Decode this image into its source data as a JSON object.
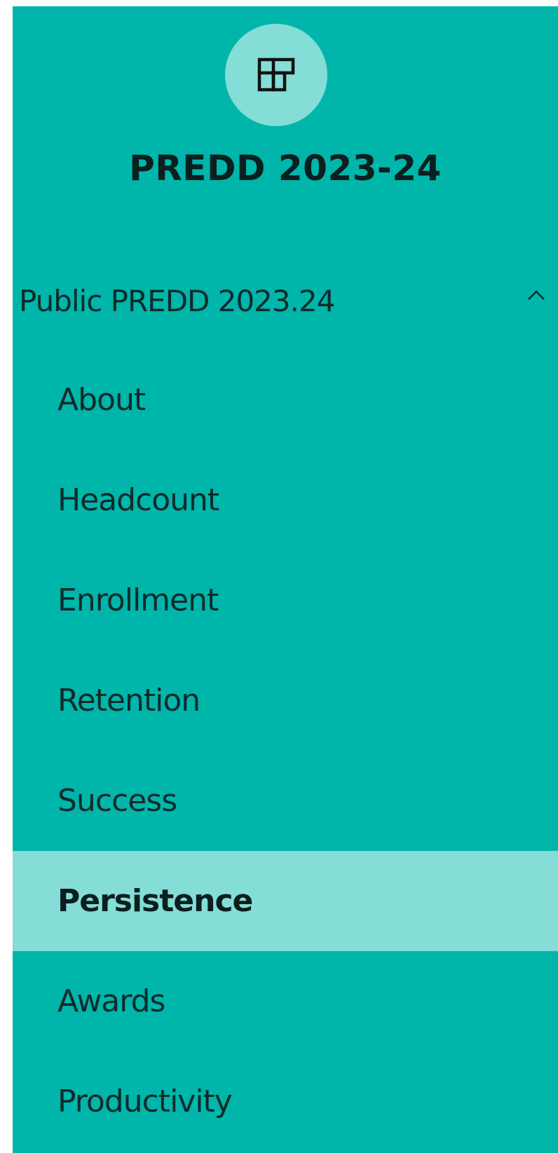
{
  "sidebar": {
    "logo_icon": "report-pages-icon",
    "title": "PREDD 2023-24",
    "section": {
      "label": "Public PREDD 2023.24",
      "expanded": true,
      "toggle_icon": "chevron-up-icon"
    },
    "items": [
      {
        "label": "About",
        "active": false
      },
      {
        "label": "Headcount",
        "active": false
      },
      {
        "label": "Enrollment",
        "active": false
      },
      {
        "label": "Retention",
        "active": false
      },
      {
        "label": "Success",
        "active": false
      },
      {
        "label": "Persistence",
        "active": true
      },
      {
        "label": "Awards",
        "active": false
      },
      {
        "label": "Productivity",
        "active": false
      }
    ]
  },
  "colors": {
    "sidebar_bg": "#00b5aa",
    "highlight": "#84ddd6",
    "text": "#0f2a2a"
  }
}
